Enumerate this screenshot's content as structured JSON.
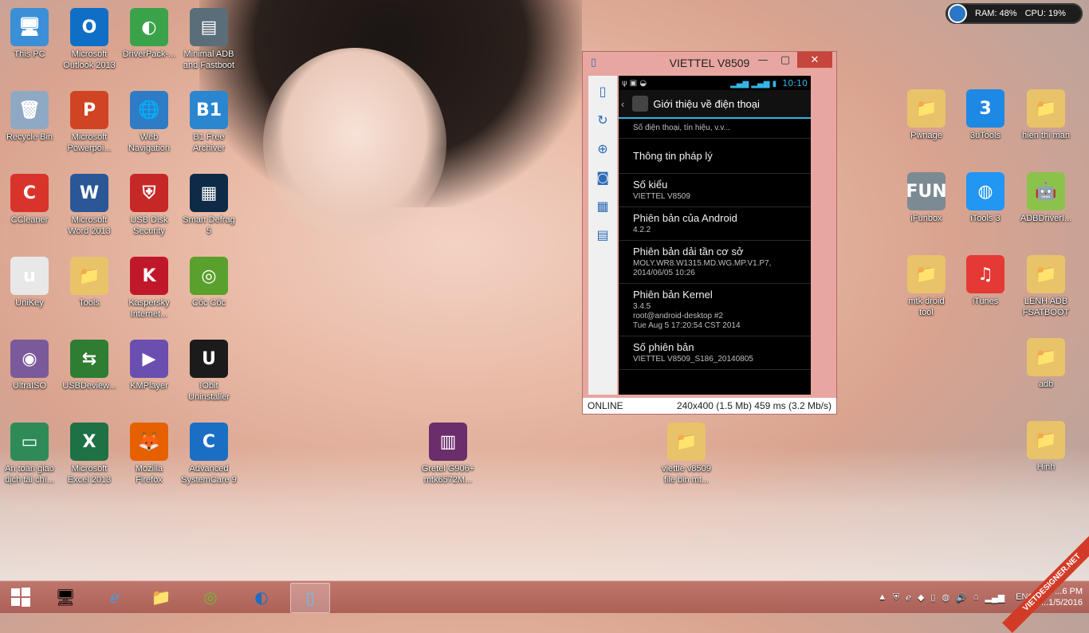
{
  "desktop": {
    "left_icons": [
      {
        "label": "This PC",
        "icon": "computer-icon",
        "color": "#3b8fd6",
        "glyph": "🖥"
      },
      {
        "label": "Microsoft\nOutlook 2013",
        "icon": "outlook-icon",
        "color": "#0f6fc6",
        "glyph": "O"
      },
      {
        "label": "DriverPack-...",
        "icon": "driverpack-icon",
        "color": "#3aa34a",
        "glyph": "◐"
      },
      {
        "label": "Minimal ADB\nand Fastboot",
        "icon": "adb-icon",
        "color": "#5a6e7a",
        "glyph": "▤"
      },
      {
        "label": "Recycle Bin",
        "icon": "recycle-bin-icon",
        "color": "#8fa9c4",
        "glyph": "🗑"
      },
      {
        "label": "Microsoft\nPowerpoi...",
        "icon": "powerpoint-icon",
        "color": "#d04423",
        "glyph": "P"
      },
      {
        "label": "Web\nNavigation",
        "icon": "globe-icon",
        "color": "#2f7cc6",
        "glyph": "🌐"
      },
      {
        "label": "B1 Free\nArchiver",
        "icon": "b1-archiver-icon",
        "color": "#2b86d0",
        "glyph": "B1"
      },
      {
        "label": "CCleaner",
        "icon": "ccleaner-icon",
        "color": "#d9342b",
        "glyph": "C"
      },
      {
        "label": "Microsoft\nWord 2013",
        "icon": "word-icon",
        "color": "#2b5797",
        "glyph": "W"
      },
      {
        "label": "USB Disk\nSecurity",
        "icon": "shield-icon",
        "color": "#c62828",
        "glyph": "⛨"
      },
      {
        "label": "Smart Defrag\n5",
        "icon": "smart-defrag-icon",
        "color": "#0e2a47",
        "glyph": "▦"
      },
      {
        "label": "UniKey",
        "icon": "unikey-icon",
        "color": "#e8e8e8",
        "glyph": "u"
      },
      {
        "label": "Tools",
        "icon": "folder-icon",
        "color": "#e8c36a",
        "glyph": "📁"
      },
      {
        "label": "Kaspersky\nInternet...",
        "icon": "kaspersky-icon",
        "color": "#c0182a",
        "glyph": "K"
      },
      {
        "label": "Cốc Cốc",
        "icon": "coccoc-icon",
        "color": "#5aa02c",
        "glyph": "◎"
      },
      {
        "label": "UltraISO",
        "icon": "disc-icon",
        "color": "#7a5a9a",
        "glyph": "◉"
      },
      {
        "label": "USBDeview...",
        "icon": "usb-icon",
        "color": "#2e7d32",
        "glyph": "⇆"
      },
      {
        "label": "KMPlayer",
        "icon": "kmplayer-icon",
        "color": "#6a4fb0",
        "glyph": "▶"
      },
      {
        "label": "IObit\nUninstaller",
        "icon": "iobit-icon",
        "color": "#1b1b1b",
        "glyph": "U"
      },
      {
        "label": "An toàn giao\ndịch tài chí...",
        "icon": "card-icon",
        "color": "#2e8b57",
        "glyph": "▭"
      },
      {
        "label": "Microsoft\nExcel 2013",
        "icon": "excel-icon",
        "color": "#1e7145",
        "glyph": "X"
      },
      {
        "label": "Mozilla\nFirefox",
        "icon": "firefox-icon",
        "color": "#e66000",
        "glyph": "🦊"
      },
      {
        "label": "Advanced\nSystemCare 9",
        "icon": "systemcare-icon",
        "color": "#1a6fc4",
        "glyph": "C"
      }
    ],
    "middle_icons": [
      {
        "label": "Gretel G906+\nmtk6572M...",
        "icon": "winrar-icon",
        "color": "#6b2d6b",
        "glyph": "▥"
      },
      {
        "label": "viettle v8509\nfile bin mt...",
        "icon": "folder-icon",
        "color": "#e8c36a",
        "glyph": "📁"
      }
    ],
    "right_icons": [
      {
        "label": "Pwnage",
        "icon": "folder-icon",
        "color": "#e8c36a",
        "glyph": "📁"
      },
      {
        "label": "3uTools",
        "icon": "3utools-icon",
        "color": "#1e88e5",
        "glyph": "3"
      },
      {
        "label": "hien thi man",
        "icon": "folder-icon",
        "color": "#e8c36a",
        "glyph": "📁"
      },
      {
        "label": "iFunbox",
        "icon": "ifunbox-icon",
        "color": "#7b8a93",
        "glyph": "FUN"
      },
      {
        "label": "iTools 3",
        "icon": "itools-icon",
        "color": "#2196f3",
        "glyph": "◍"
      },
      {
        "label": "ADBDriverI...",
        "icon": "android-usb-icon",
        "color": "#8bc34a",
        "glyph": "🤖"
      },
      {
        "label": "mtk droid\ntool",
        "icon": "folder-icon",
        "color": "#e8c36a",
        "glyph": "📁"
      },
      {
        "label": "iTunes",
        "icon": "itunes-icon",
        "color": "#e53935",
        "glyph": "♫"
      },
      {
        "label": "LENH ADB\nFSATBOOT",
        "icon": "folder-icon",
        "color": "#e8c36a",
        "glyph": "📁"
      },
      {
        "label": "adb",
        "icon": "folder-icon",
        "color": "#e8c36a",
        "glyph": "📁"
      },
      {
        "label": "Hinh",
        "icon": "folder-icon",
        "color": "#e8c36a",
        "glyph": "📁"
      }
    ]
  },
  "sysmon": {
    "ram": "RAM: 48%",
    "cpu": "CPU: 19%"
  },
  "window": {
    "title": "VIETTEL V8509",
    "status_left": "ONLINE",
    "status_right": "240x400 (1.5 Mb)  459 ms (3.2 Mb/s)",
    "phone": {
      "time": "10:10",
      "action_title": "Giới thiệu về điện thoại",
      "rows": [
        {
          "title": "",
          "sub": "Số điện thoại, tín hiệu, v.v..."
        },
        {
          "title": "Thông tin pháp lý",
          "sub": ""
        },
        {
          "title": "Số kiểu",
          "sub": "VIETTEL V8509"
        },
        {
          "title": "Phiên bản của Android",
          "sub": "4.2.2"
        },
        {
          "title": "Phiên bản dải tần cơ sở",
          "sub": "MOLY.WR8.W1315.MD.WG.MP.V1.P7,\n2014/06/05 10:26"
        },
        {
          "title": "Phiên bản Kernel",
          "sub": "3.4.5\nroot@android-desktop #2\nTue Aug 5 17:20:54 CST 2014"
        },
        {
          "title": "Số phiên bản",
          "sub": "VIETTEL V8509_S186_20140805"
        }
      ]
    }
  },
  "taskbar": {
    "lang": "ENG",
    "time": "...6 PM",
    "date": "...1/5/2016"
  },
  "watermark": "VIETDESIGNER.NET"
}
